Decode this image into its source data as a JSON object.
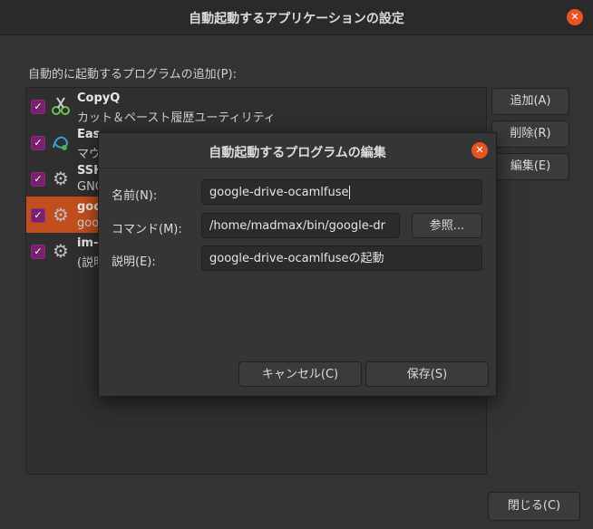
{
  "window": {
    "title": "自動起動するアプリケーションの設定",
    "close_label": "✕"
  },
  "list": {
    "label": "自動的に起動するプログラムの追加(P):",
    "items": [
      {
        "name": "CopyQ",
        "desc": "カット＆ペースト履歴ユーティリティ",
        "checked": true,
        "icon": "copyq-scissors-icon"
      },
      {
        "name": "Eas",
        "desc": "マウ",
        "checked": true,
        "icon": "easystroke-icon"
      },
      {
        "name": "SSH",
        "desc": "GNO",
        "checked": true,
        "icon": "gears-icon"
      },
      {
        "name": "goo",
        "desc": "goo",
        "checked": true,
        "icon": "gears-icon",
        "selected": true
      },
      {
        "name": "im-",
        "desc": "(説明",
        "checked": true,
        "icon": "gears-icon"
      }
    ]
  },
  "buttons": {
    "add": "追加(A)",
    "remove": "削除(R)",
    "edit": "編集(E)",
    "close": "閉じる(C)"
  },
  "dialog": {
    "title": "自動起動するプログラムの編集",
    "close_label": "✕",
    "name_label": "名前(N):",
    "name_value": "google-drive-ocamlfuse",
    "command_label": "コマンド(M):",
    "command_value": "/home/madmax/bin/google-dr",
    "browse": "参照...",
    "desc_label": "説明(E):",
    "desc_value": "google-drive-ocamlfuseの起動",
    "cancel": "キャンセル(C)",
    "save": "保存(S)"
  },
  "colors": {
    "accent": "#e95420",
    "selection": "#c14e1c",
    "checkbox": "#77216f"
  }
}
